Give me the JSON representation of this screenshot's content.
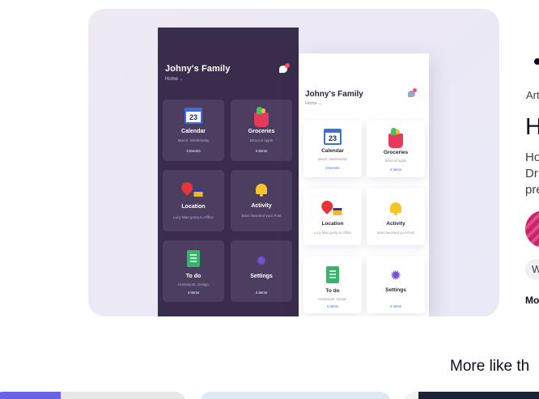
{
  "shot": {
    "dark": {
      "title": "Johny's Family",
      "subtitle": "Home",
      "tiles": [
        {
          "name": "Calendar",
          "sub": "March, Wednesday",
          "count": "3 Events",
          "icon": "calendar-icon",
          "day": "23"
        },
        {
          "name": "Groceries",
          "sub": "Broccoli Apple",
          "count": "4 items",
          "icon": "groceries-bag-icon"
        },
        {
          "name": "Location",
          "sub": "Lucy Mao going to Office",
          "count": "",
          "icon": "location-pin-icon"
        },
        {
          "name": "Activity",
          "sub": "Boss favorited your Post",
          "count": "",
          "icon": "bell-icon"
        },
        {
          "name": "To do",
          "sub": "Homework, Design",
          "count": "4 items",
          "icon": "todo-list-icon"
        },
        {
          "name": "Settings",
          "sub": "",
          "count": "4 items",
          "icon": "gear-icon"
        }
      ]
    },
    "light": {
      "title": "Johny's Family",
      "subtitle": "Home",
      "tiles": [
        {
          "name": "Calendar",
          "sub": "March, Wednesday",
          "count": "3 Events",
          "icon": "calendar-icon",
          "day": "23"
        },
        {
          "name": "Groceries",
          "sub": "Broccoli Apple",
          "count": "4 items",
          "icon": "groceries-bag-icon"
        },
        {
          "name": "Location",
          "sub": "Lucy Mao going to Office",
          "count": "",
          "icon": "location-pin-icon"
        },
        {
          "name": "Activity",
          "sub": "Boss favorited your Post",
          "count": "",
          "icon": "bell-icon"
        },
        {
          "name": "To do",
          "sub": "Homework, Design",
          "count": "4 items",
          "icon": "todo-list-icon"
        },
        {
          "name": "Settings",
          "sub": "",
          "count": "4 items",
          "icon": "gear-icon"
        }
      ]
    }
  },
  "sidebar": {
    "label_fragment": "Art",
    "heading_fragment": "H",
    "desc_line1": "Ho",
    "desc_line2": "Dr",
    "desc_line3": "pre",
    "tag_fragment": "W",
    "more_fragment": "Mo"
  },
  "section": {
    "more_like_this": "More like th"
  },
  "colors": {
    "dark_bg": "#3a2c4d",
    "dark_tile": "#4c3e60",
    "accent_blue": "#3d6bd8",
    "notification_red": "#ff4e6b"
  }
}
